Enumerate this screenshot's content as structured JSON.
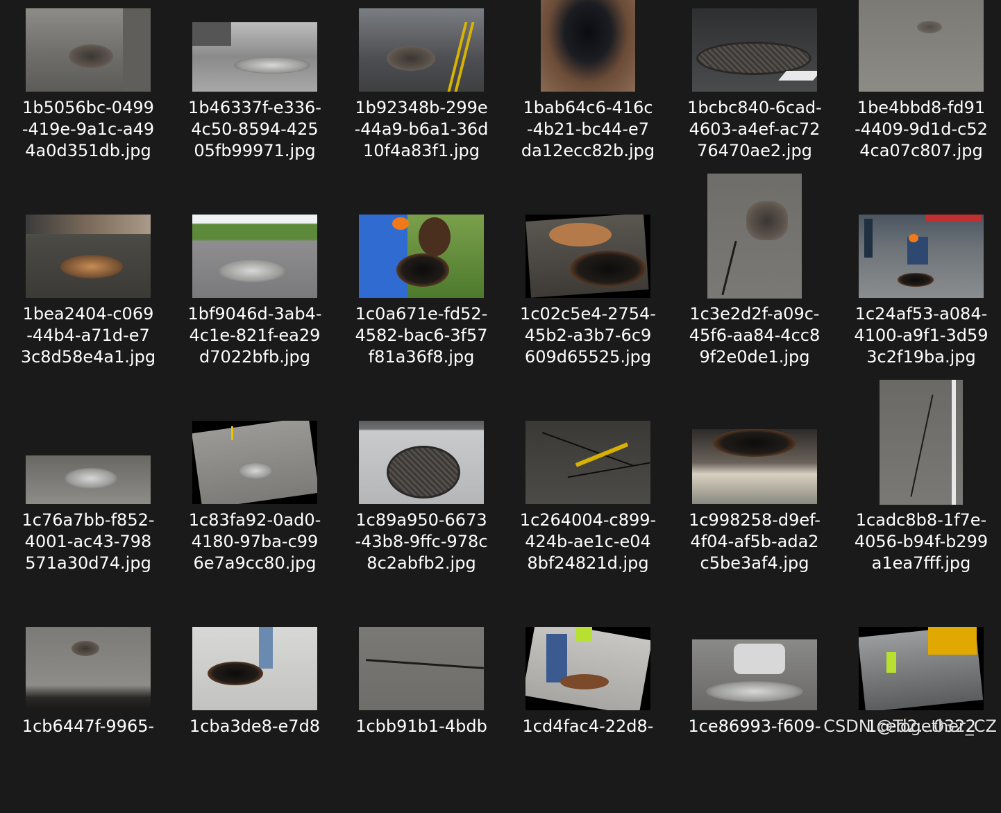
{
  "files": [
    {
      "name": "1b5056bc-0499-419e-9a1c-a494a0d351db.jpg",
      "lines": [
        "1b5056bc-0499",
        "-419e-9a1c-a49",
        "4a0d351db.jpg"
      ]
    },
    {
      "name": "1b46337f-e336-4c50-8594-42505fb99971.jpg",
      "lines": [
        "1b46337f-e336-",
        "4c50-8594-425",
        "05fb99971.jpg"
      ]
    },
    {
      "name": "1b92348b-299e-44a9-b6a1-36d10f4a83f1.jpg",
      "lines": [
        "1b92348b-299e",
        "-44a9-b6a1-36d",
        "10f4a83f1.jpg"
      ]
    },
    {
      "name": "1bab64c6-416c-4b21-bc44-e7da12ecc82b.jpg",
      "lines": [
        "1bab64c6-416c",
        "-4b21-bc44-e7",
        "da12ecc82b.jpg"
      ]
    },
    {
      "name": "1bcbc840-6cad-4603-a4ef-ac7276470ae2.jpg",
      "lines": [
        "1bcbc840-6cad-",
        "4603-a4ef-ac72",
        "76470ae2.jpg"
      ]
    },
    {
      "name": "1be4bbd8-fd91-4409-9d1d-c524ca07c807.jpg",
      "lines": [
        "1be4bbd8-fd91",
        "-4409-9d1d-c52",
        "4ca07c807.jpg"
      ]
    },
    {
      "name": "1bea2404-c069-44b4-a71d-e73c8d58e4a1.jpg",
      "lines": [
        "1bea2404-c069",
        "-44b4-a71d-e7",
        "3c8d58e4a1.jpg"
      ]
    },
    {
      "name": "1bf9046d-3ab4-4c1e-821f-ea29d7022bfb.jpg",
      "lines": [
        "1bf9046d-3ab4-",
        "4c1e-821f-ea29",
        "d7022bfb.jpg"
      ]
    },
    {
      "name": "1c0a671e-fd52-4582-bac6-3f57f81a36f8.jpg",
      "lines": [
        "1c0a671e-fd52-",
        "4582-bac6-3f57",
        "f81a36f8.jpg"
      ]
    },
    {
      "name": "1c02c5e4-2754-45b2-a3b7-6c9609d65525.jpg",
      "lines": [
        "1c02c5e4-2754-",
        "45b2-a3b7-6c9",
        "609d65525.jpg"
      ]
    },
    {
      "name": "1c3e2d2f-a09c-45f6-aa84-4cc89f2e0de1.jpg",
      "lines": [
        "1c3e2d2f-a09c-",
        "45f6-aa84-4cc8",
        "9f2e0de1.jpg"
      ]
    },
    {
      "name": "1c24af53-a084-4100-a9f1-3d593c2f19ba.jpg",
      "lines": [
        "1c24af53-a084-",
        "4100-a9f1-3d59",
        "3c2f19ba.jpg"
      ]
    },
    {
      "name": "1c76a7bb-f852-4001-ac43-798571a30d74.jpg",
      "lines": [
        "1c76a7bb-f852-",
        "4001-ac43-798",
        "571a30d74.jpg"
      ]
    },
    {
      "name": "1c83fa92-0ad0-4180-97ba-c996e7a9cc80.jpg",
      "lines": [
        "1c83fa92-0ad0-",
        "4180-97ba-c99",
        "6e7a9cc80.jpg"
      ]
    },
    {
      "name": "1c89a950-6673-43b8-9ffc-978c8c2abfb2.jpg",
      "lines": [
        "1c89a950-6673",
        "-43b8-9ffc-978c",
        "8c2abfb2.jpg"
      ]
    },
    {
      "name": "1c264004-c899-424b-ae1c-e048bf24821d.jpg",
      "lines": [
        "1c264004-c899-",
        "424b-ae1c-e04",
        "8bf24821d.jpg"
      ]
    },
    {
      "name": "1c998258-d9ef-4f04-af5b-ada2c5be3af4.jpg",
      "lines": [
        "1c998258-d9ef-",
        "4f04-af5b-ada2",
        "c5be3af4.jpg"
      ]
    },
    {
      "name": "1cadc8b8-1f7e-4056-b94f-b299a1ea7fff.jpg",
      "lines": [
        "1cadc8b8-1f7e-",
        "4056-b94f-b299",
        "a1ea7fff.jpg"
      ]
    },
    {
      "name": "1cb6447f-9965-",
      "lines": [
        "1cb6447f-9965-"
      ]
    },
    {
      "name": "1cba3de8-e7d8",
      "lines": [
        "1cba3de8-e7d8"
      ]
    },
    {
      "name": "1cbb91b1-4bdb",
      "lines": [
        "1cbb91b1-4bdb"
      ]
    },
    {
      "name": "1cd4fac4-22d8-",
      "lines": [
        "1cd4fac4-22d8-"
      ]
    },
    {
      "name": "1ce86993-f609-",
      "lines": [
        "1ce86993-f609-"
      ]
    },
    {
      "name": "1ced2...0322",
      "lines": [
        "1ced2...0322"
      ]
    }
  ],
  "watermark": "CSDN @Together_CZ"
}
